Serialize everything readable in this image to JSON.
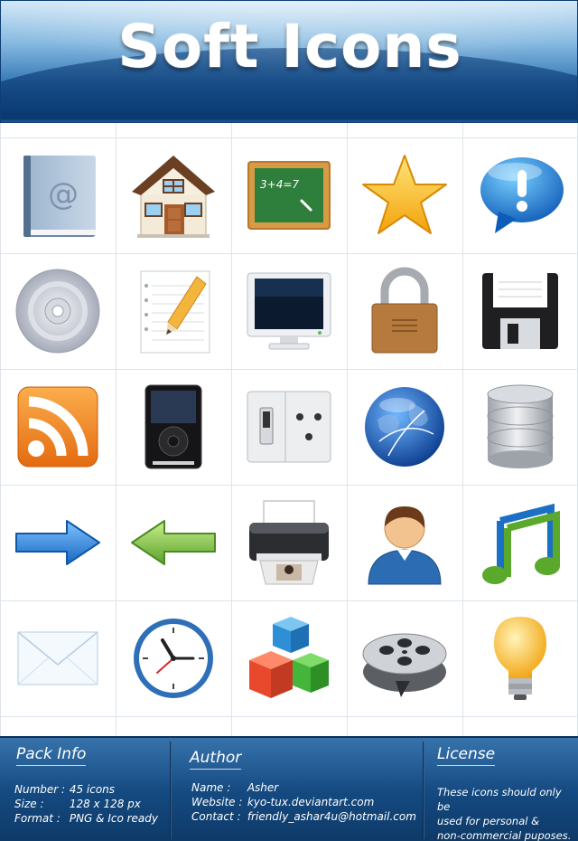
{
  "header": {
    "title": "Soft Icons"
  },
  "icons": [
    "address-book-icon",
    "home-icon",
    "chalkboard-icon",
    "star-icon",
    "speech-bubble-alert-icon",
    "cd-disc-icon",
    "notepad-pencil-icon",
    "monitor-icon",
    "padlock-icon",
    "floppy-disk-icon",
    "rss-feed-icon",
    "media-player-icon",
    "switch-socket-icon",
    "globe-network-icon",
    "database-icon",
    "arrow-right-icon",
    "arrow-left-icon",
    "printer-icon",
    "user-icon",
    "music-notes-icon",
    "envelope-icon",
    "clock-icon",
    "blocks-icon",
    "film-reel-icon",
    "light-bulb-icon"
  ],
  "icon_texts": {
    "address_book_symbol": "@",
    "chalkboard_equation": "3+4=7"
  },
  "footer": {
    "pack_info": {
      "heading": "Pack Info",
      "rows": [
        {
          "label": "Number :",
          "value": "45 icons"
        },
        {
          "label": "Size :",
          "value": "128 x 128 px"
        },
        {
          "label": "Format :",
          "value": "PNG & Ico ready"
        }
      ]
    },
    "author": {
      "heading": "Author",
      "rows": [
        {
          "label": "Name :",
          "value": "Asher"
        },
        {
          "label": "Website :",
          "value": "kyo-tux.deviantart.com"
        },
        {
          "label": "Contact :",
          "value": "friendly_ashar4u@hotmail.com"
        }
      ]
    },
    "license": {
      "heading": "License",
      "lines": [
        "These icons should only be",
        "used for personal &",
        "non-commercial puposes."
      ]
    }
  },
  "colors": {
    "header_blue": "#2e73b3",
    "footer_blue": "#14497f",
    "grid_line": "#dde4ea"
  }
}
